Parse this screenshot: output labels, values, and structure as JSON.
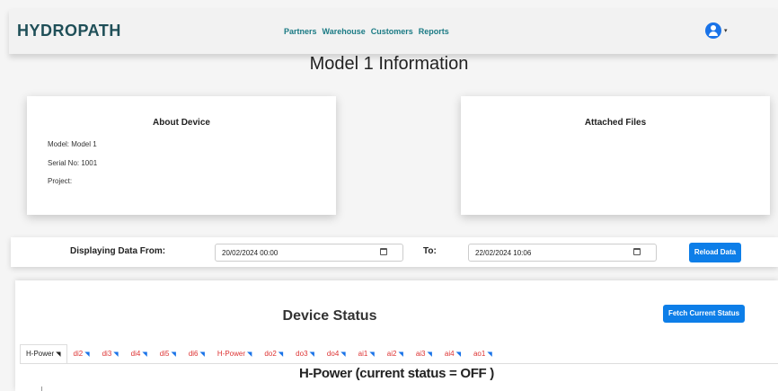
{
  "header": {
    "brand": "HYDROPATH",
    "nav": [
      "Partners",
      "Warehouse",
      "Customers",
      "Reports"
    ]
  },
  "page": {
    "title": "Model 1 Information"
  },
  "about": {
    "title": "About Device",
    "model": "Model: Model 1",
    "serial": "Serial No: 1001",
    "project": "Project:"
  },
  "files": {
    "title": "Attached Files"
  },
  "range": {
    "from_label": "Displaying Data From:",
    "from_value": "20/02/2024 00:00",
    "to_label": "To:",
    "to_value": "22/02/2024 10:06",
    "reload_label": "Reload Data"
  },
  "status": {
    "title": "Device Status",
    "fetch_label": "Fetch Current Status",
    "tabs": [
      "H-Power",
      "di2",
      "di3",
      "di4",
      "di5",
      "di6",
      "H-Power",
      "do2",
      "do3",
      "do4",
      "ai1",
      "ai2",
      "ai3",
      "ai4",
      "ao1"
    ],
    "current": "H-Power (current status = OFF )"
  },
  "colors": {
    "accent": "#0d7ee8",
    "brand": "#1f4f58",
    "nav_link": "#1a7a84",
    "tab_text": "#dd3333"
  }
}
